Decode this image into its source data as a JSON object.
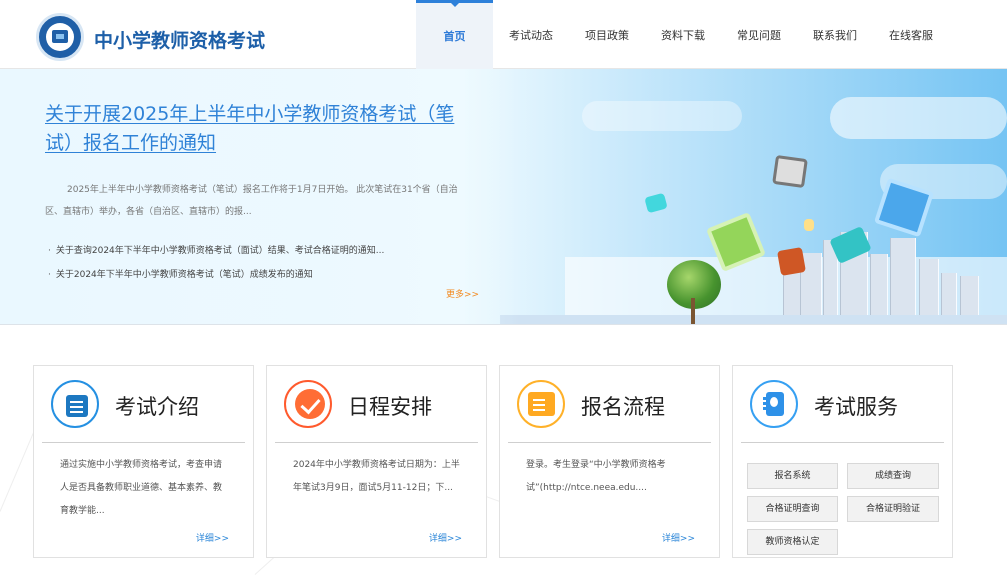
{
  "header": {
    "site_title": "中小学教师资格考试",
    "nav": [
      "首页",
      "考试动态",
      "项目政策",
      "资料下载",
      "常见问题",
      "联系我们",
      "在线客服"
    ]
  },
  "banner": {
    "headline": "关于开展2025年上半年中小学教师资格考试（笔试）报名工作的通知",
    "summary": "2025年上半年中小学教师资格考试（笔试）报名工作将于1月7日开始。 此次笔试在31个省（自治区、直辖市）举办，各省（自治区、直辖市）的报...",
    "news": [
      "关于查询2024年下半年中小学教师资格考试（面试）结果、考试合格证明的通知...",
      "关于2024年下半年中小学教师资格考试（笔试）成绩发布的通知"
    ],
    "more": "更多>>"
  },
  "cards": [
    {
      "title": "考试介绍",
      "text": "通过实施中小学教师资格考试，考查申请人是否具备教师职业道德、基本素养、教育教学能...",
      "detail": "详细>>"
    },
    {
      "title": "日程安排",
      "text": "2024年中小学教师资格考试日期为：上半年笔试3月9日，面试5月11-12日；下...",
      "detail": "详细>>"
    },
    {
      "title": "报名流程",
      "text": "登录。考生登录“中小学教师资格考试”(http://ntce.neea.edu....",
      "detail": "详细>>"
    },
    {
      "title": "考试服务",
      "services": [
        "报名系统",
        "成绩查询",
        "合格证明查询",
        "合格证明验证",
        "教师资格认定"
      ]
    }
  ],
  "colors": {
    "primary_blue": "#2d80da",
    "logo_blue": "#1f5fa7",
    "accent_orange": "#f28b22",
    "intro_icon": "#1d78c1",
    "schedule_icon": "#ff6d35",
    "process_icon": "#ffa921",
    "service_icon": "#2e91e8"
  },
  "icons": {
    "logo": "school-emblem-icon",
    "intro": "document-icon",
    "schedule": "checkmark-icon",
    "process": "form-icon",
    "service": "contact-book-icon"
  }
}
